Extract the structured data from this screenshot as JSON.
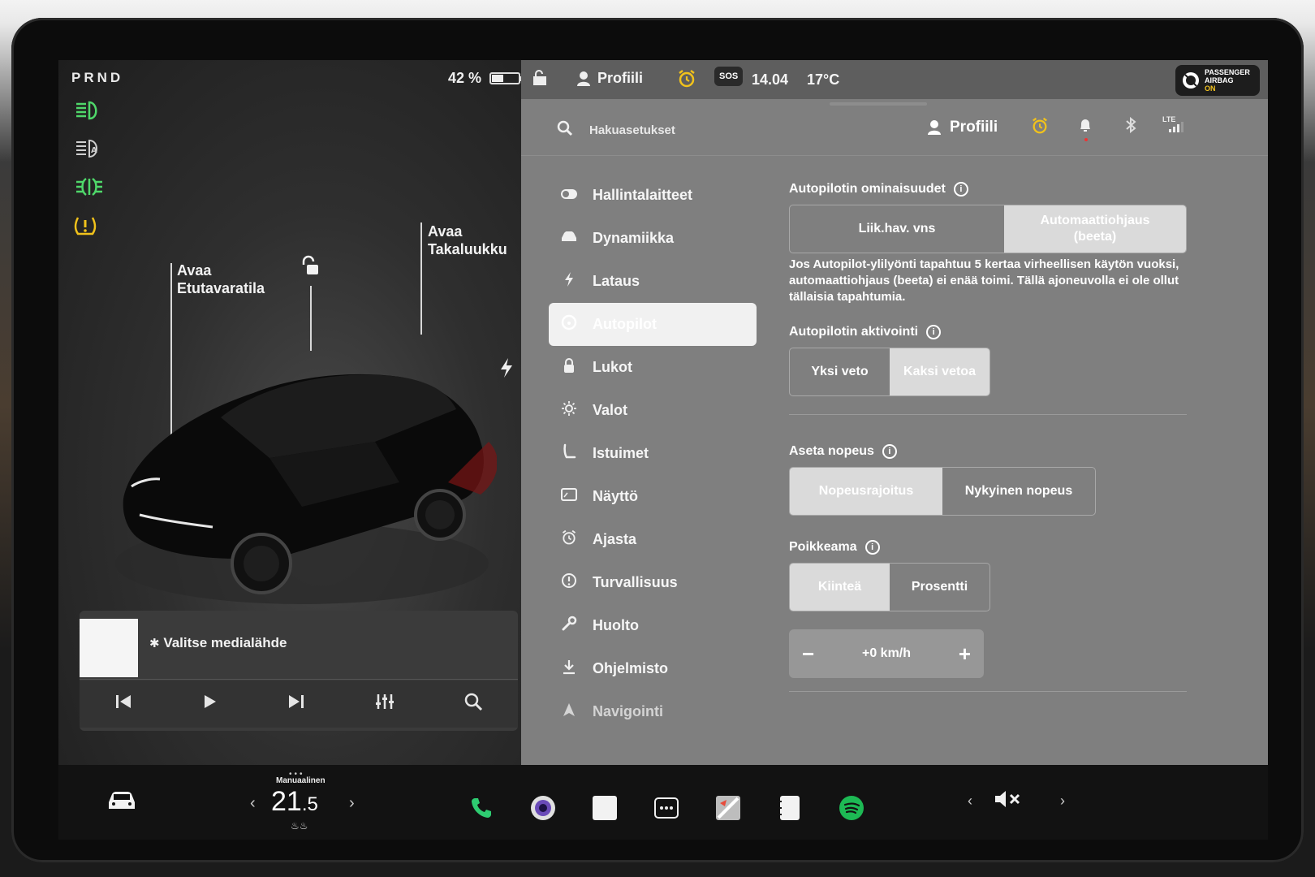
{
  "left_panel": {
    "gear": "PRND",
    "battery_percent": "42 %",
    "battery_level": 0.42,
    "callout_frunk": [
      "Avaa",
      "Etutavaratila"
    ],
    "callout_trunk": [
      "Avaa",
      "Takaluukku"
    ]
  },
  "media": {
    "source_label": "Valitse medialähde",
    "controls": [
      "previous-icon",
      "play-icon",
      "next-icon",
      "equalizer-icon",
      "search-icon"
    ]
  },
  "topbar": {
    "profile": "Profiili",
    "sos": "SOS",
    "time": "14.04",
    "temperature": "17°C",
    "airbag_label": "PASSENGER AIRBAG",
    "airbag_state": "ON"
  },
  "search": {
    "placeholder": "Hakuasetukset",
    "profile": "Profiili",
    "lte": "LTE"
  },
  "nav": {
    "items": [
      {
        "label": "Hallintalaitteet",
        "icon": "toggle-icon"
      },
      {
        "label": "Dynamiikka",
        "icon": "car-icon"
      },
      {
        "label": "Lataus",
        "icon": "bolt-icon"
      },
      {
        "label": "Autopilot",
        "icon": "steering-wheel-icon",
        "active": true
      },
      {
        "label": "Lukot",
        "icon": "lock-icon"
      },
      {
        "label": "Valot",
        "icon": "sun-icon"
      },
      {
        "label": "Istuimet",
        "icon": "seat-icon"
      },
      {
        "label": "Näyttö",
        "icon": "display-icon"
      },
      {
        "label": "Ajasta",
        "icon": "alarm-icon"
      },
      {
        "label": "Turvallisuus",
        "icon": "warning-icon"
      },
      {
        "label": "Huolto",
        "icon": "wrench-icon"
      },
      {
        "label": "Ohjelmisto",
        "icon": "download-icon"
      },
      {
        "label": "Navigointi",
        "icon": "navigation-icon"
      }
    ]
  },
  "autopilot": {
    "features_title": "Autopilotin ominaisuudet",
    "features_options": [
      "Liik.hav. vns",
      "Automaattiohjaus (beeta)"
    ],
    "features_selected": 1,
    "features_desc": "Jos Autopilot-ylilyönti tapahtuu 5 kertaa virheellisen käytön vuoksi, automaattiohjaus (beeta) ei enää toimi. Tällä ajoneuvolla ei ole ollut tällaisia tapahtumia.",
    "activation_title": "Autopilotin aktivointi",
    "activation_options": [
      "Yksi veto",
      "Kaksi vetoa"
    ],
    "activation_selected": 1,
    "speed_title": "Aseta nopeus",
    "speed_options": [
      "Nopeusrajoitus",
      "Nykyinen nopeus"
    ],
    "speed_selected": 0,
    "offset_title": "Poikkeama",
    "offset_options": [
      "Kiinteä",
      "Prosentti"
    ],
    "offset_selected": 0,
    "offset_value": "+0 km/h",
    "minus": "−",
    "plus": "+"
  },
  "dock": {
    "climate_label": "Manuaalinen",
    "temp_int": "21",
    "temp_dec": ".5",
    "apps": [
      "phone-icon",
      "camera-icon",
      "blank-app-icon",
      "more-icon",
      "map-icon",
      "notes-icon",
      "spotify-icon"
    ]
  },
  "colors": {
    "green_telltale": "#4fd86a",
    "yellow_alarm": "#f1c21b",
    "spotify_green": "#1db954"
  }
}
